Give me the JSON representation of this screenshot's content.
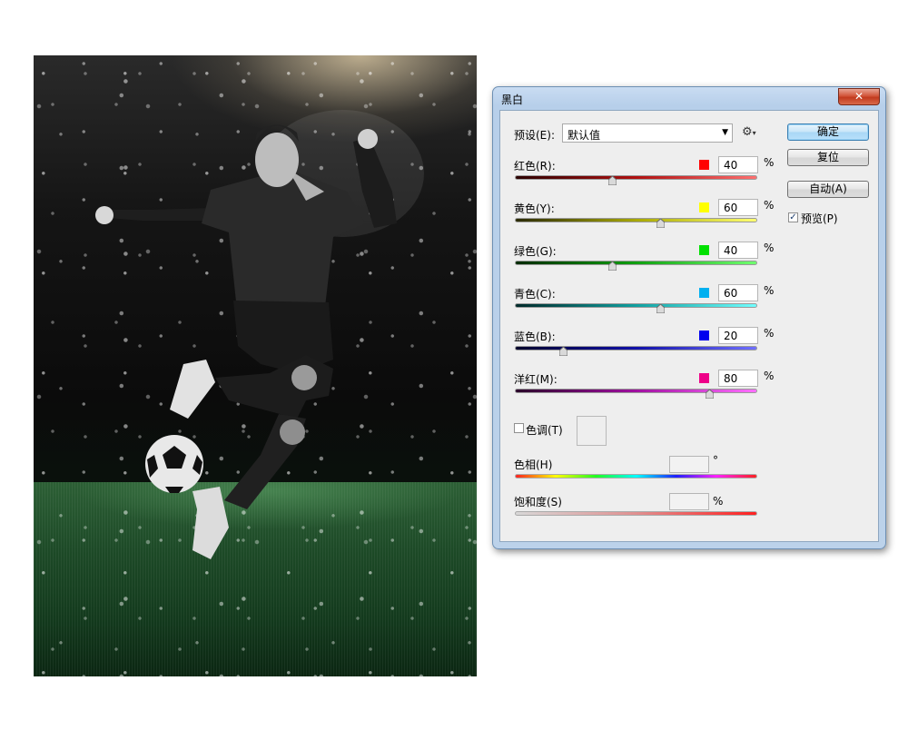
{
  "dialog": {
    "title": "黑白",
    "close_label": "✕",
    "preset_label": "预设(E):",
    "preset_value": "默认值",
    "sliders": [
      {
        "label": "红色(R):",
        "value": "40",
        "unit": "%",
        "swatch": "#ff0000",
        "level": 0.4,
        "gradient": [
          "#2a0000",
          "#b01010",
          "#ff7070"
        ]
      },
      {
        "label": "黄色(Y):",
        "value": "60",
        "unit": "%",
        "swatch": "#ffff00",
        "level": 0.6,
        "gradient": [
          "#2a2a00",
          "#a8a800",
          "#ffff70"
        ]
      },
      {
        "label": "绿色(G):",
        "value": "40",
        "unit": "%",
        "swatch": "#00e000",
        "level": 0.4,
        "gradient": [
          "#002a00",
          "#10a010",
          "#70ff70"
        ]
      },
      {
        "label": "青色(C):",
        "value": "60",
        "unit": "%",
        "swatch": "#00b0f0",
        "level": 0.6,
        "gradient": [
          "#002a2a",
          "#10a0a0",
          "#70ffff"
        ]
      },
      {
        "label": "蓝色(B):",
        "value": "20",
        "unit": "%",
        "swatch": "#0000ee",
        "level": 0.2,
        "gradient": [
          "#00002a",
          "#1010a8",
          "#7070ff"
        ]
      },
      {
        "label": "洋红(M):",
        "value": "80",
        "unit": "%",
        "swatch": "#ee0088",
        "level": 0.8,
        "gradient": [
          "#2a002a",
          "#a010a0",
          "#ff70ff"
        ]
      }
    ],
    "tint_label": "色调(T)",
    "hue_label": "色相(H)",
    "hue_unit": "°",
    "saturation_label": "饱和度(S)",
    "saturation_unit": "%",
    "buttons": {
      "ok": "确定",
      "reset": "复位",
      "auto": "自动(A)"
    },
    "preview_label": "预览(P)",
    "preview_checked": true,
    "tint_checked": false
  }
}
